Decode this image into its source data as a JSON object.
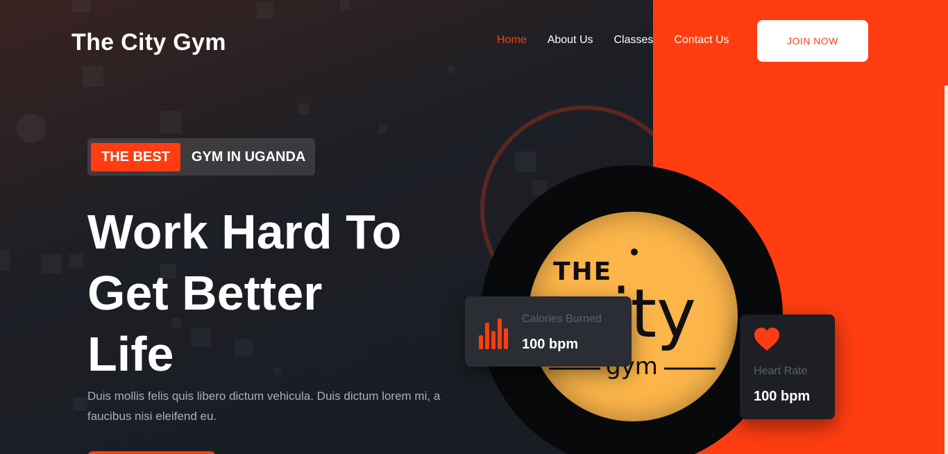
{
  "brand": {
    "name": "The City Gym"
  },
  "nav": {
    "items": [
      {
        "label": "Home",
        "active": true
      },
      {
        "label": "About Us",
        "active": false
      },
      {
        "label": "Classes",
        "active": false
      },
      {
        "label": "Contact Us",
        "active": false
      }
    ],
    "join_label": "JOIN NOW"
  },
  "hero": {
    "tag_highlight": "THE BEST",
    "tag_rest": "GYM IN UGANDA",
    "headline_lines": [
      "Work Hard To",
      "Get Better",
      "Life"
    ],
    "description": "Duis mollis felis quis libero dictum vehicula. Duis dictum lorem mi, a faucibus nisi eleifend eu."
  },
  "logo": {
    "word_top": "THE",
    "word_main": "city",
    "word_bottom": "gym"
  },
  "stats": {
    "calories": {
      "label": "Calories Burned",
      "value": "100 bpm",
      "icon": "bar-chart-icon"
    },
    "heart": {
      "label": "Heart Rate",
      "value": "100 bpm",
      "icon": "heart-icon"
    }
  },
  "colors": {
    "accent": "#ff3d11",
    "logo_bg": "#fcb54a",
    "dark": "#171b22"
  }
}
